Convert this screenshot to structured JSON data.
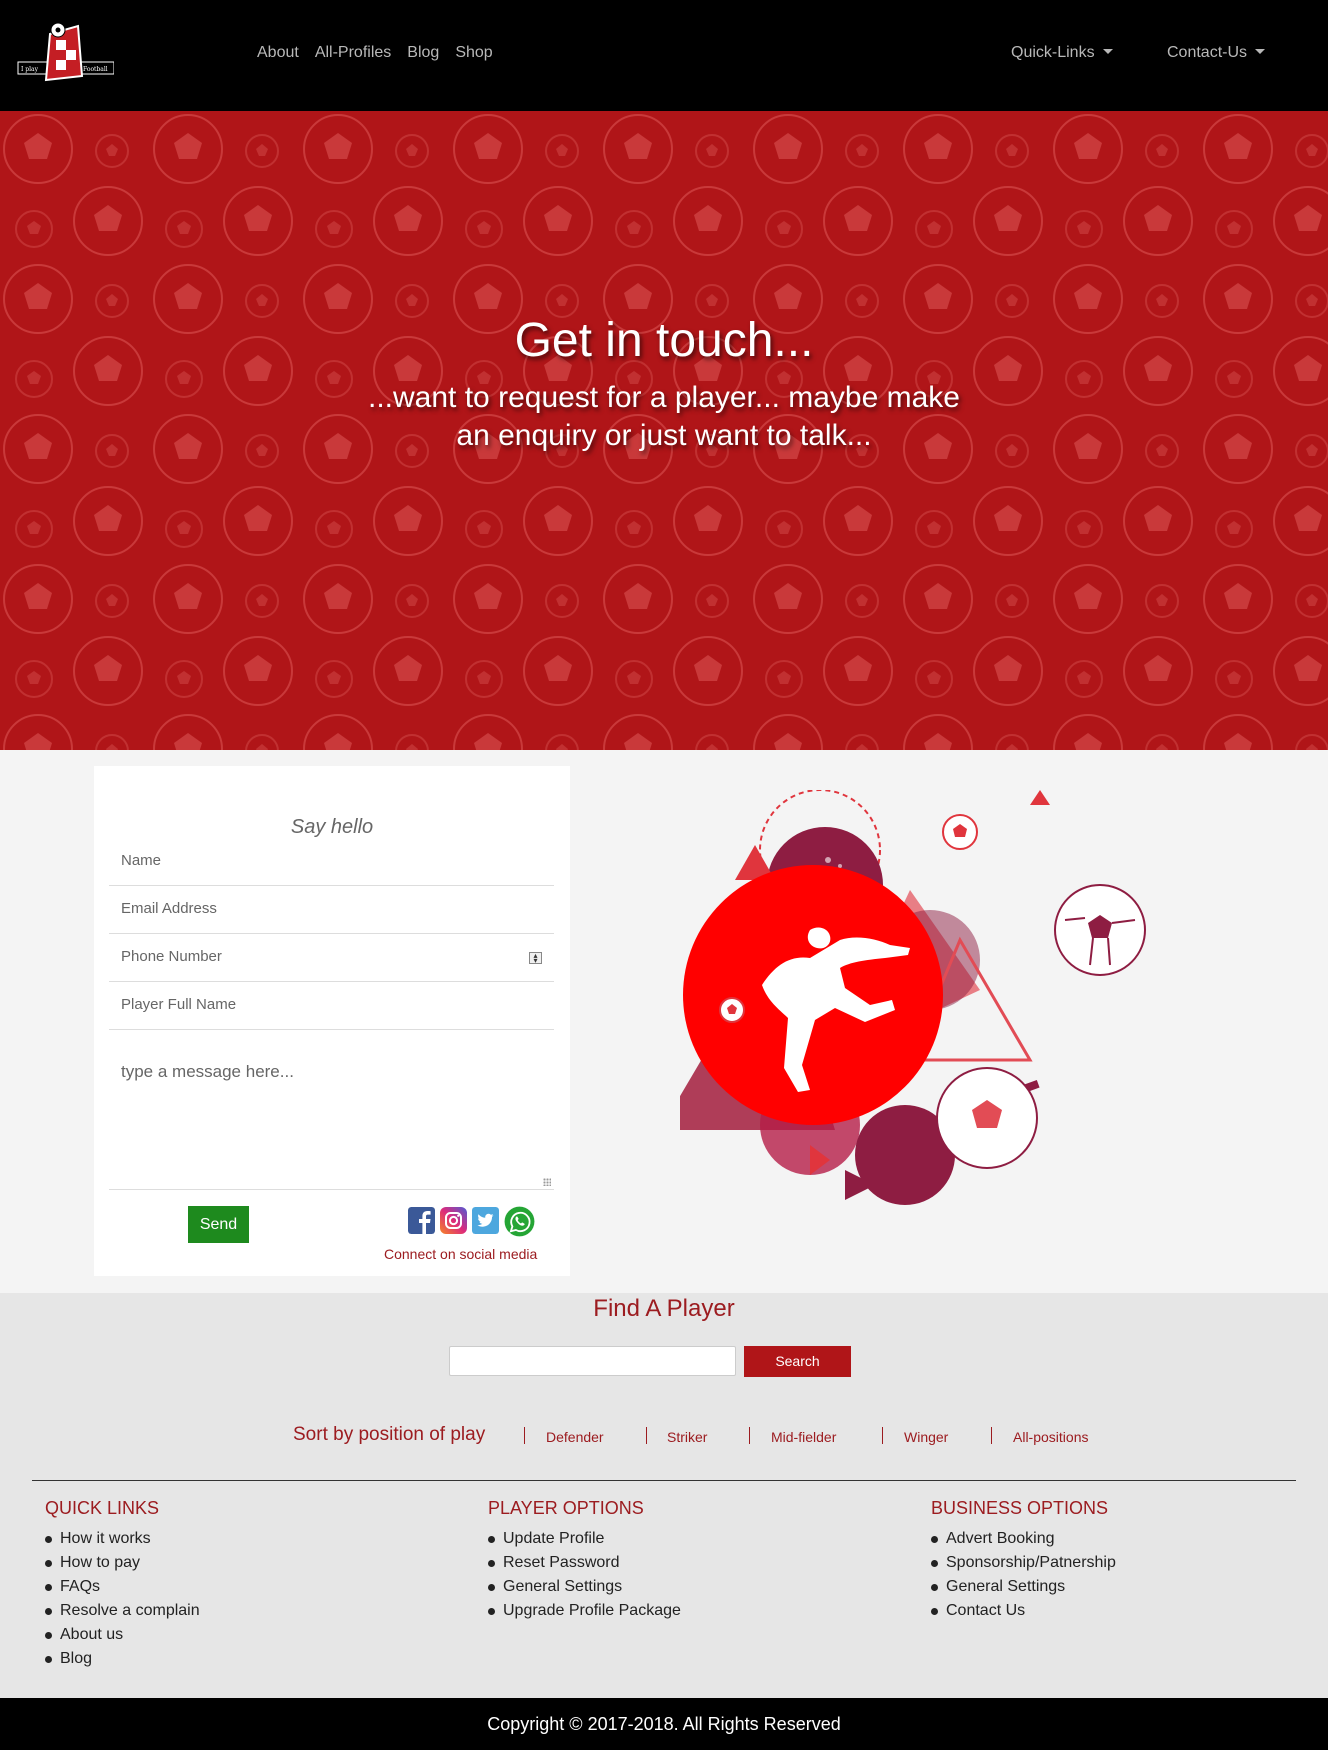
{
  "nav": {
    "logo_text_left": "I play",
    "logo_text_right": "Football",
    "links": [
      "About",
      "All-Profiles",
      "Blog",
      "Shop"
    ],
    "quick_links": "Quick-Links",
    "contact_us": "Contact-Us"
  },
  "hero": {
    "title": "Get in touch...",
    "subtitle": "...want to request for a player... maybe make an enquiry or just want to talk..."
  },
  "form": {
    "title": "Say hello",
    "name_placeholder": "Name",
    "email_placeholder": "Email Address",
    "phone_placeholder": "Phone Number",
    "player_placeholder": "Player Full Name",
    "message_placeholder": "type a message here...",
    "send_label": "Send",
    "social_caption": "Connect on social media",
    "social_icons": [
      "facebook-icon",
      "instagram-icon",
      "twitter-icon",
      "whatsapp-icon"
    ]
  },
  "find": {
    "title": "Find A Player",
    "search_value": "",
    "search_label": "Search",
    "sort_label": "Sort by position of play",
    "positions": [
      "Defender",
      "Striker",
      "Mid-fielder",
      "Winger",
      "All-positions"
    ]
  },
  "footer": {
    "quick_links": {
      "title": "QUICK LINKS",
      "items": [
        "How it works",
        "How to pay",
        "FAQs",
        "Resolve a complain",
        "About us",
        "Blog"
      ]
    },
    "player_options": {
      "title": "PLAYER OPTIONS",
      "items": [
        "Update Profile",
        "Reset Password",
        "General Settings",
        "Upgrade Profile Package"
      ]
    },
    "business_options": {
      "title": "BUSINESS OPTIONS",
      "items": [
        "Advert Booking",
        "Sponsorship/Patnership",
        "General Settings",
        "Contact Us"
      ]
    },
    "copyright": "Copyright © 2017-2018. All Rights Reserved"
  },
  "colors": {
    "brand_red": "#b01518",
    "link_red": "#9c1c20",
    "send_green": "#1e8a1e",
    "nav_bg": "#000000"
  }
}
